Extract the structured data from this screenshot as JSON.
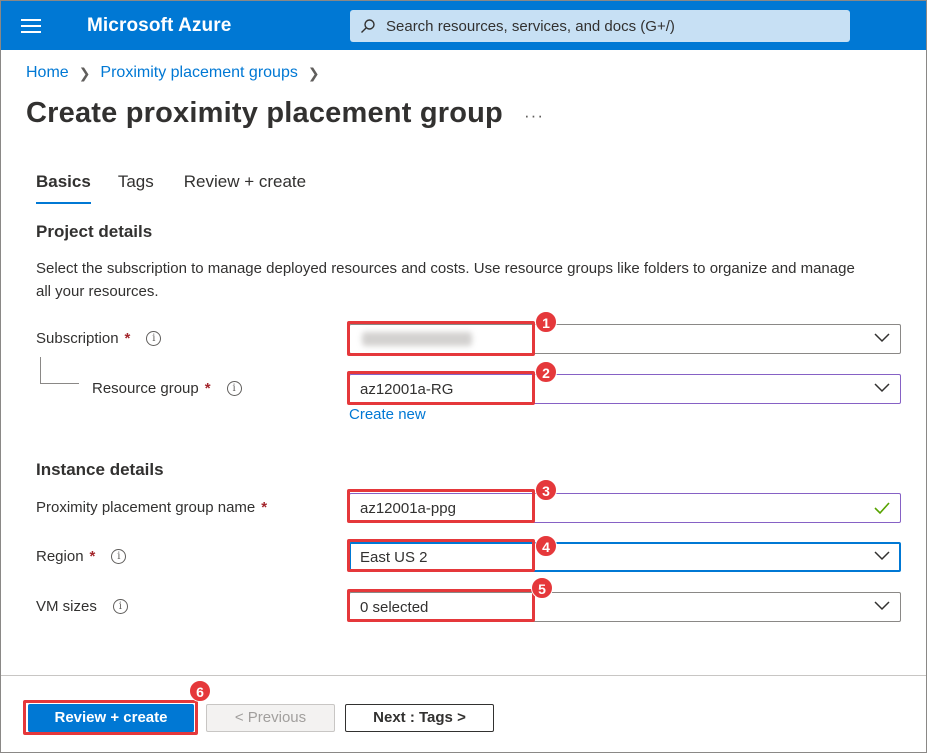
{
  "header": {
    "brand": "Microsoft Azure",
    "search_placeholder": "Search resources, services, and docs (G+/)"
  },
  "breadcrumb": {
    "home": "Home",
    "parent": "Proximity placement groups"
  },
  "page": {
    "title": "Create proximity placement group",
    "more": "···"
  },
  "tabs": [
    {
      "label": "Basics"
    },
    {
      "label": "Tags"
    },
    {
      "label": "Review + create"
    }
  ],
  "project": {
    "title": "Project details",
    "description": "Select the subscription to manage deployed resources and costs. Use resource groups like folders to organize and manage all your resources.",
    "subscription_label": "Subscription",
    "resource_group_label": "Resource group",
    "resource_group_value": "az12001a-RG",
    "create_new": "Create new"
  },
  "instance": {
    "title": "Instance details",
    "name_label": "Proximity placement group name",
    "name_value": "az12001a-ppg",
    "region_label": "Region",
    "region_value": "East US 2",
    "vm_sizes_label": "VM sizes",
    "vm_sizes_value": "0 selected"
  },
  "required_mark": "*",
  "info_glyph": "i",
  "annotations": [
    "1",
    "2",
    "3",
    "4",
    "5",
    "6"
  ],
  "footer": {
    "review_create": "Review + create",
    "previous": "< Previous",
    "next": "Next : Tags >"
  },
  "colors": {
    "accent": "#0078d4",
    "highlight": "#e5383b",
    "required": "#a4262c"
  }
}
